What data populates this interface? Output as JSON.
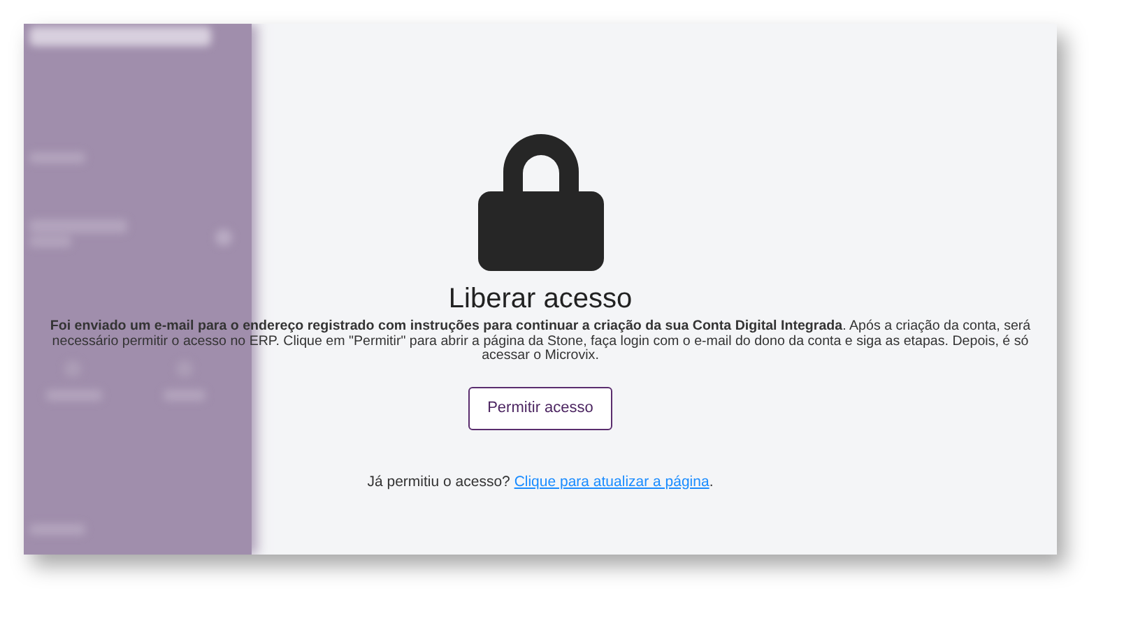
{
  "title": "Liberar acesso",
  "message": "**Foi enviado um e-mail para o endereço registrado com instruções para continuar a criação da sua Conta Digital Integrada**. Após a criação da conta, será necessário permitir o acesso no ERP. Clique em \"Permitir\" para abrir a página da Stone, faça login com o e-mail do dono da conta e siga as etapas. Depois, é só acessar o Microvix.",
  "button": "Permitir acesso",
  "refresh": {
    "prefix": "Já permitiu o acesso? ",
    "link": "Clique para atualizar a página",
    "suffix": "."
  }
}
